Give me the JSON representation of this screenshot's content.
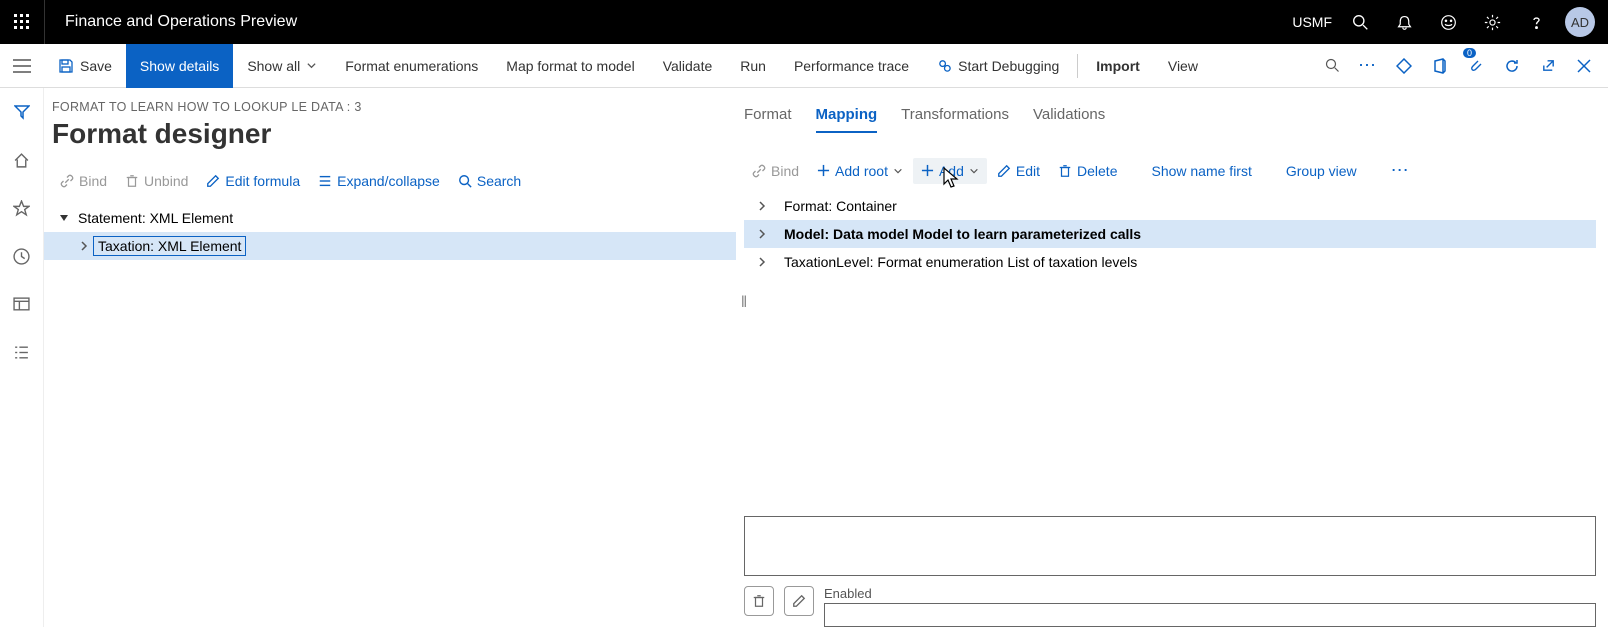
{
  "topbar": {
    "title": "Finance and Operations Preview",
    "company": "USMF",
    "avatar": "AD"
  },
  "cmdbar": {
    "save": "Save",
    "showDetails": "Show details",
    "showAll": "Show all",
    "formatEnum": "Format enumerations",
    "mapFormat": "Map format to model",
    "validate": "Validate",
    "run": "Run",
    "perfTrace": "Performance trace",
    "startDebug": "Start Debugging",
    "import": "Import",
    "view": "View",
    "badge": "0"
  },
  "page": {
    "breadcrumb": "FORMAT TO LEARN HOW TO LOOKUP LE DATA : 3",
    "title": "Format designer"
  },
  "leftToolbar": {
    "bind": "Bind",
    "unbind": "Unbind",
    "editFormula": "Edit formula",
    "expand": "Expand/collapse",
    "search": "Search"
  },
  "leftTree": {
    "root": "Statement: XML Element",
    "child": "Taxation: XML Element"
  },
  "rightTabs": {
    "format": "Format",
    "mapping": "Mapping",
    "transformations": "Transformations",
    "validations": "Validations"
  },
  "rightToolbar": {
    "bind": "Bind",
    "addRoot": "Add root",
    "add": "Add",
    "edit": "Edit",
    "delete": "Delete",
    "showNameFirst": "Show name first",
    "groupView": "Group view"
  },
  "rightTree": {
    "n1": "Format: Container",
    "n2": "Model: Data model Model to learn parameterized calls",
    "n3": "TaxationLevel: Format enumeration List of taxation levels"
  },
  "bottom": {
    "enabled": "Enabled"
  }
}
